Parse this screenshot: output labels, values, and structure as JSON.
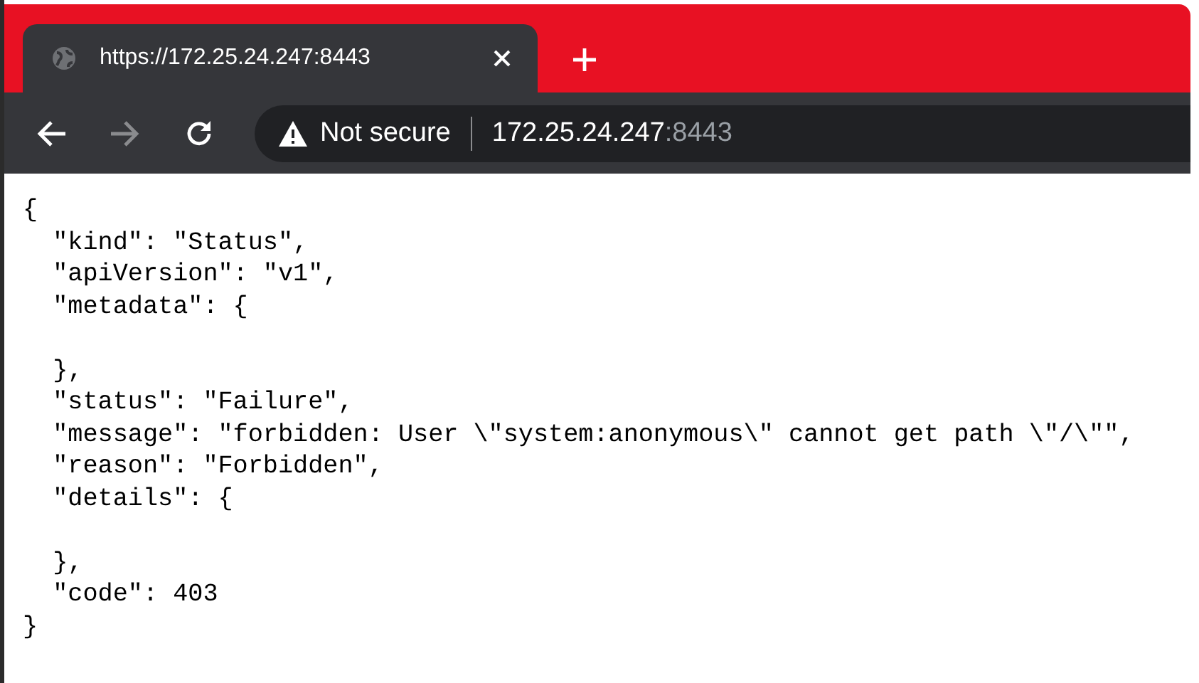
{
  "tab": {
    "title": "https://172.25.24.247:8443",
    "selected": true
  },
  "toolbar": {
    "security_label": "Not secure",
    "url_host": "172.25.24.247",
    "url_port": ":8443"
  },
  "page_blocks": [
    [
      "{",
      "  \"kind\": \"Status\",",
      "  \"apiVersion\": \"v1\",",
      "  \"metadata\": {"
    ],
    [
      "  },",
      "  \"status\": \"Failure\",",
      "  \"message\": \"forbidden: User \\\"system:anonymous\\\" cannot get path \\\"/\\\"\",",
      "  \"reason\": \"Forbidden\",",
      "  \"details\": {"
    ],
    [
      "  },",
      "  \"code\": 403",
      "}"
    ]
  ]
}
